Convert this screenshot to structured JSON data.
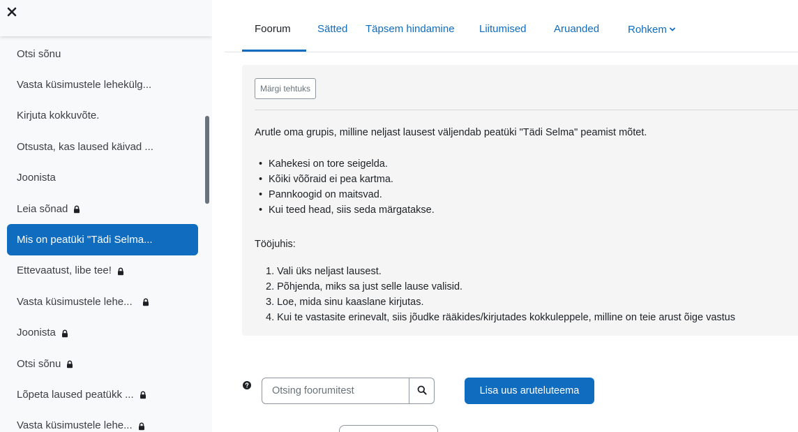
{
  "sidebar": {
    "close_icon": "close-icon",
    "items": [
      {
        "label": "Otsi sõnu",
        "locked": false,
        "active": false
      },
      {
        "label": "Vasta küsimustele lehekülg...",
        "locked": false,
        "active": false
      },
      {
        "label": "Kirjuta kokkuvõte.",
        "locked": false,
        "active": false
      },
      {
        "label": "Otsusta, kas laused käivad ...",
        "locked": false,
        "active": false
      },
      {
        "label": "Joonista",
        "locked": false,
        "active": false
      },
      {
        "label": "Leia sõnad",
        "locked": true,
        "active": false
      },
      {
        "label": "Mis on peatüki \"Tädi Selma...",
        "locked": false,
        "active": true
      },
      {
        "label": "Ettevaatust, libe tee!",
        "locked": true,
        "active": false
      },
      {
        "label": "Vasta küsimustele lehe...",
        "locked": true,
        "active": false
      },
      {
        "label": "Joonista",
        "locked": true,
        "active": false
      },
      {
        "label": "Otsi sõnu",
        "locked": true,
        "active": false
      },
      {
        "label": "Lõpeta laused peatükk ...",
        "locked": true,
        "active": false
      },
      {
        "label": "Vasta küsimustele lehe...",
        "locked": true,
        "active": false
      }
    ]
  },
  "tabs": [
    {
      "label": "Foorum",
      "active": true
    },
    {
      "label": "Sätted",
      "active": false
    },
    {
      "label": "Täpsem hindamine",
      "active": false
    },
    {
      "label": "Liitumised",
      "active": false
    },
    {
      "label": "Aruanded",
      "active": false
    },
    {
      "label": "Rohkem",
      "active": false,
      "dropdown": true
    }
  ],
  "content": {
    "mark_done_label": "Märgi tehtuks",
    "intro": "Arutle oma grupis, milline neljast lausest väljendab peatüki \"Tädi Selma\" peamist mõtet.",
    "bullets": [
      "Kahekesi on tore seigelda.",
      "Kõiki võõraid ei pea kartma.",
      "Pannkoogid on maitsvad.",
      "Kui teed head, siis seda märgatakse."
    ],
    "instructions_title": "Tööjuhis:",
    "steps": [
      "1. Vali üks neljast lausest.",
      "2. Põhjenda, miks sa just selle lause valisid.",
      "3. Loe, mida sinu kaaslane kirjutas.",
      "4. Kui te vastasite erinevalt, siis jõudke rääkides/kirjutades kokkuleppele, milline on teie arust õige vastus"
    ]
  },
  "search": {
    "placeholder": "Otsing foorumitest",
    "value": "",
    "help_icon": "question-circle-icon",
    "button_icon": "search-icon"
  },
  "add_topic_label": "Lisa uus aruteluteema",
  "colors": {
    "primary": "#0f6cbf",
    "sidebar_bg": "#f8f9fa",
    "content_bg": "#f5f5f5",
    "text": "#1d2125"
  }
}
